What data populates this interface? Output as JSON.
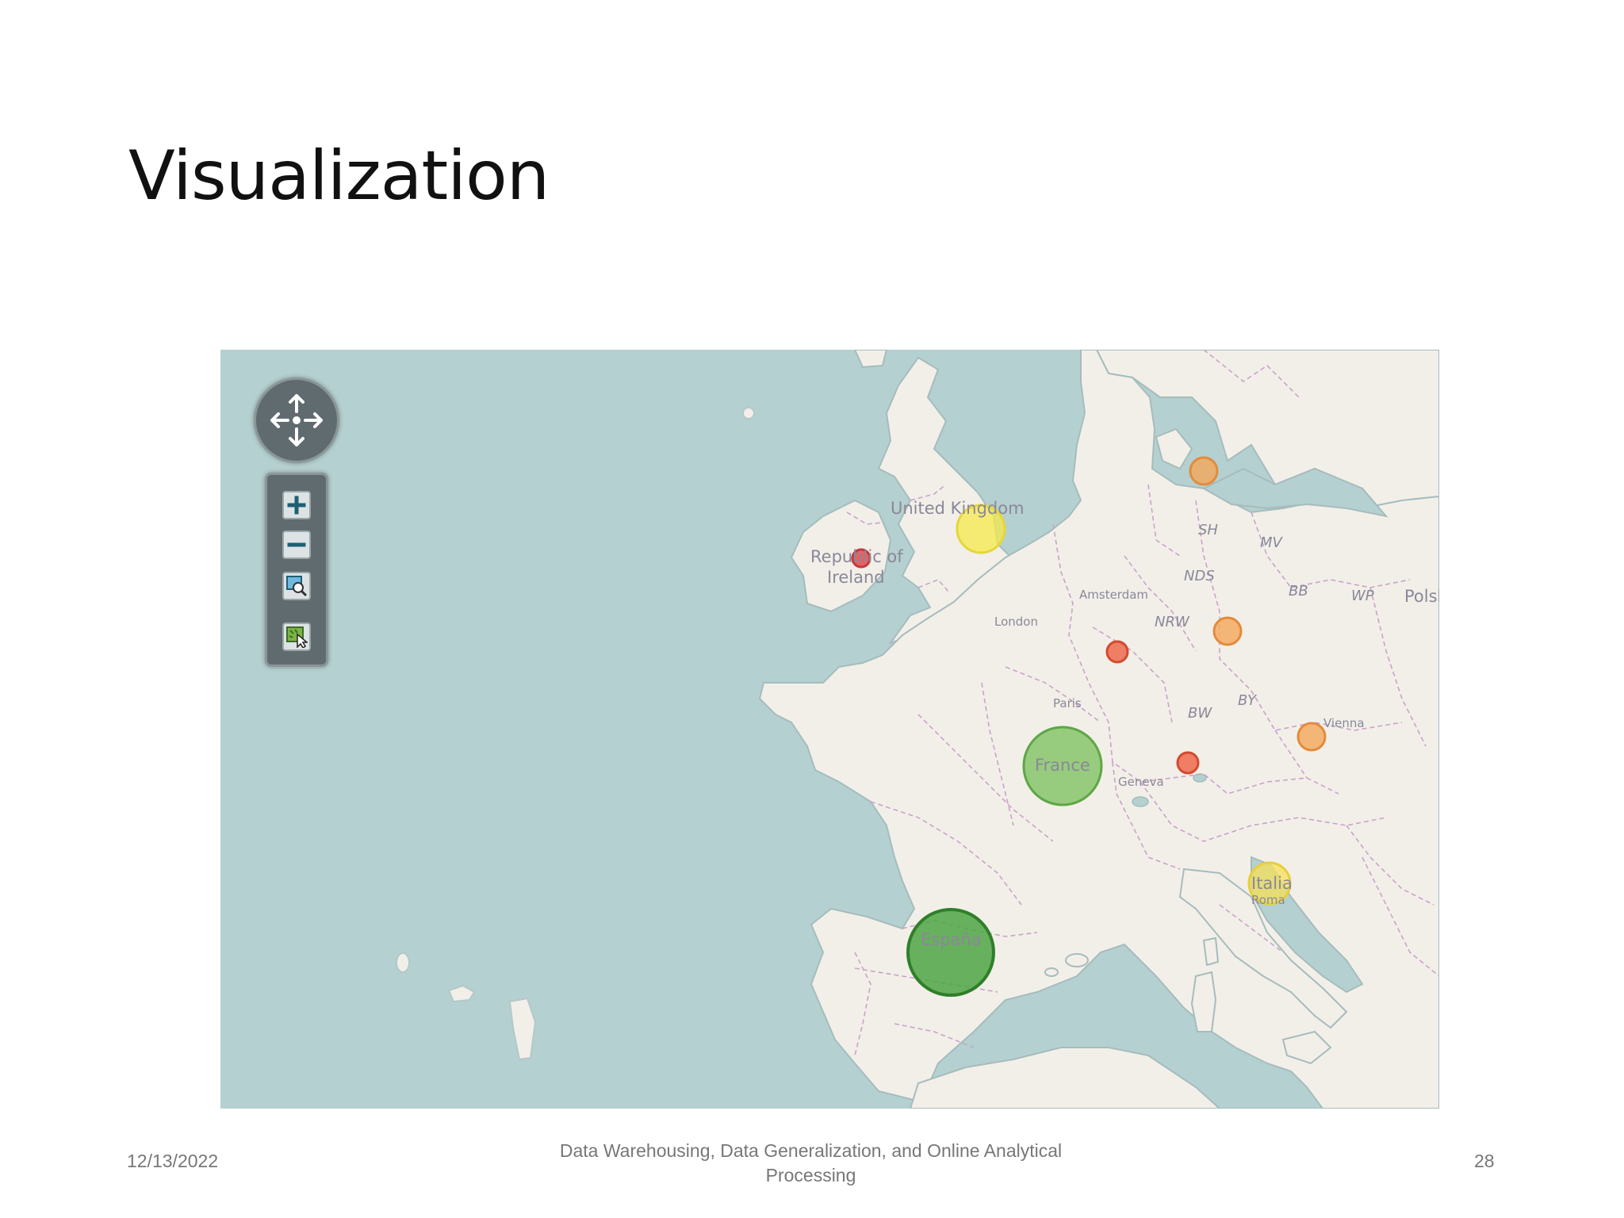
{
  "slide": {
    "title": "Visualization"
  },
  "map": {
    "labels": {
      "united_kingdom": "United Kingdom",
      "ireland_1": "Republic of",
      "ireland_2": "Ireland",
      "london": "London",
      "amsterdam": "Amsterdam",
      "paris": "Paris",
      "geneva": "Geneva",
      "vienna": "Vienna",
      "rome": "Roma",
      "france": "France",
      "espana": "España",
      "italia": "Italia",
      "polska": "Polska",
      "sh": "SH",
      "mv": "MV",
      "nds": "NDS",
      "nrw": "NRW",
      "bb": "BB",
      "wp": "WP",
      "bw": "BW",
      "by": "BY"
    },
    "markers": [
      {
        "name": "marker-ireland",
        "color": "#e8474a",
        "size": "small"
      },
      {
        "name": "marker-united-kingdom",
        "color": "#f5e94a",
        "size": "medium"
      },
      {
        "name": "marker-denmark",
        "color": "#f4a85a",
        "size": "small"
      },
      {
        "name": "marker-germany",
        "color": "#f4a85a",
        "size": "small"
      },
      {
        "name": "marker-belgium",
        "color": "#ee6a4c",
        "size": "small"
      },
      {
        "name": "marker-switzerland",
        "color": "#ee6a4c",
        "size": "small"
      },
      {
        "name": "marker-austria",
        "color": "#f4a85a",
        "size": "small"
      },
      {
        "name": "marker-france",
        "color": "#7fc263",
        "size": "large"
      },
      {
        "name": "marker-spain",
        "color": "#4fa544",
        "size": "large"
      },
      {
        "name": "marker-italy",
        "color": "#f5e05a",
        "size": "medium"
      }
    ],
    "controls": {
      "pan_icon": "pan-arrows-icon",
      "zoom_in": "+",
      "zoom_out": "−",
      "zoom_box_icon": "zoom-box-icon",
      "select_icon": "select-feature-icon"
    },
    "colors": {
      "water": "#b5d0d0",
      "land": "#f2efe9",
      "borders": "#c9a3c9"
    }
  },
  "footer": {
    "date": "12/13/2022",
    "title_line1": "Data Warehousing, Data Generalization, and Online Analytical",
    "title_line2": "Processing",
    "page_number": "28"
  }
}
